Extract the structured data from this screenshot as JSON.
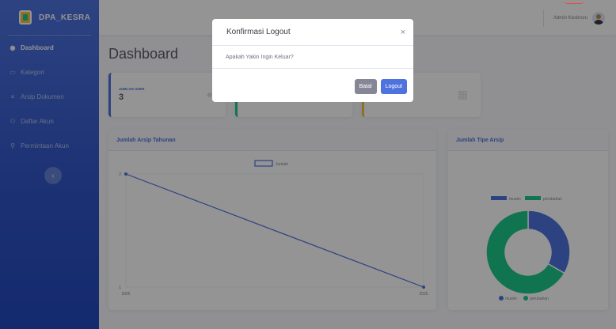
{
  "brand": {
    "name": "DPA_KESRA"
  },
  "sidebar": {
    "items": [
      {
        "label": "Dashboard",
        "icon": "tachometer-icon",
        "active": true
      },
      {
        "label": "Kategori",
        "icon": "folder-icon"
      },
      {
        "label": "Arsip Dokumen",
        "icon": "document-icon"
      },
      {
        "label": "Daftar Akun",
        "icon": "users-icon"
      },
      {
        "label": "Permintaan Akun",
        "icon": "user-plus-icon"
      }
    ],
    "toggle_icon": "‹"
  },
  "topbar": {
    "user_name": "Admin Kesbruru"
  },
  "page": {
    "title": "Dashboard"
  },
  "stats": [
    {
      "label": "JUMLAH USER",
      "value": "3"
    },
    {
      "label": "",
      "value": ""
    },
    {
      "label": "",
      "value": ""
    }
  ],
  "area_chart": {
    "title": "Jumlah Arsip Tahunan"
  },
  "pie_chart": {
    "title": "Jumlah Tipe Arsip"
  },
  "modal": {
    "title": "Konfirmasi Logout",
    "close": "×",
    "message": "Apakah Yakin Ingin Keluar?",
    "cancel_label": "Batal",
    "confirm_label": "Logout"
  },
  "colors": {
    "primary": "#4e73df",
    "success": "#1cc88a",
    "warning": "#f6c23e",
    "secondary": "#858796"
  },
  "chart_data": [
    {
      "type": "line",
      "title": "Jumlah Arsip Tahunan",
      "categories": [
        "2025",
        "2025"
      ],
      "series": [
        {
          "name": "Jumlah",
          "values": [
            2,
            1
          ]
        }
      ],
      "ylim": [
        1,
        2
      ],
      "yticks": [
        "1",
        "2"
      ],
      "legend": "top",
      "grid": true
    },
    {
      "type": "pie",
      "title": "Jumlah Tipe Arsip",
      "labels": [
        "musim",
        "perubahan"
      ],
      "values": [
        1,
        2
      ],
      "colors": [
        "#4e73df",
        "#1cc88a"
      ],
      "legend": "top and bottom"
    }
  ]
}
